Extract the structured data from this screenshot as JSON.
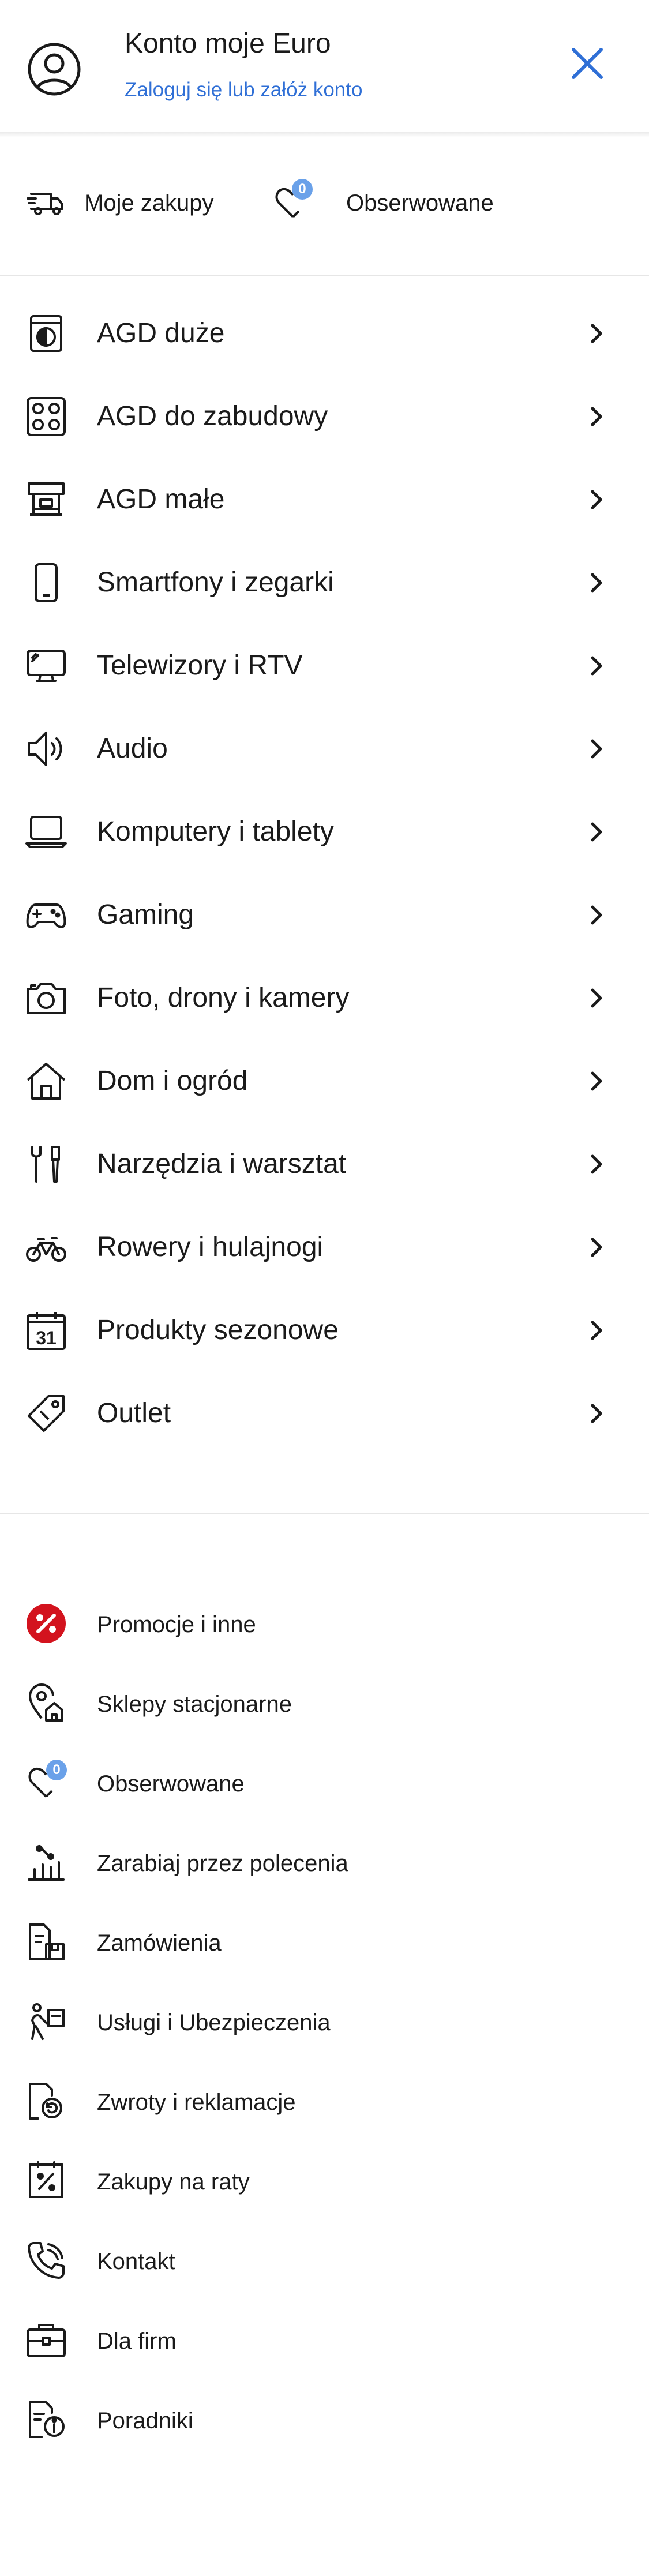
{
  "header": {
    "title": "Konto moje Euro",
    "login_link": "Zaloguj się lub załóż konto"
  },
  "quick_bar": {
    "purchases_label": "Moje zakupy",
    "watched_label": "Obserwowane",
    "watched_count": "0"
  },
  "categories": [
    {
      "label": "AGD duże",
      "icon": "washing-machine-icon"
    },
    {
      "label": "AGD do zabudowy",
      "icon": "cooktop-icon"
    },
    {
      "label": "AGD małe",
      "icon": "coffee-machine-icon"
    },
    {
      "label": "Smartfony i zegarki",
      "icon": "smartphone-icon"
    },
    {
      "label": "Telewizory i RTV",
      "icon": "tv-icon"
    },
    {
      "label": "Audio",
      "icon": "speaker-icon"
    },
    {
      "label": "Komputery i tablety",
      "icon": "laptop-icon"
    },
    {
      "label": "Gaming",
      "icon": "gamepad-icon"
    },
    {
      "label": "Foto, drony i kamery",
      "icon": "camera-icon"
    },
    {
      "label": "Dom i ogród",
      "icon": "house-icon"
    },
    {
      "label": "Narzędzia i warsztat",
      "icon": "tools-icon"
    },
    {
      "label": "Rowery i hulajnogi",
      "icon": "bicycle-icon"
    },
    {
      "label": "Produkty sezonowe",
      "icon": "calendar-icon",
      "icon_text": "31"
    },
    {
      "label": "Outlet",
      "icon": "tag-icon"
    }
  ],
  "secondary": [
    {
      "label": "Promocje i inne",
      "icon": "percent-badge-icon"
    },
    {
      "label": "Sklepy stacjonarne",
      "icon": "store-location-icon"
    },
    {
      "label": "Obserwowane",
      "icon": "heart-icon",
      "badge": "0"
    },
    {
      "label": "Zarabiaj przez polecenia",
      "icon": "referral-chart-icon"
    },
    {
      "label": "Zamówienia",
      "icon": "orders-icon"
    },
    {
      "label": "Usługi i Ubezpieczenia",
      "icon": "services-icon"
    },
    {
      "label": "Zwroty i reklamacje",
      "icon": "returns-icon"
    },
    {
      "label": "Zakupy na raty",
      "icon": "installments-icon"
    },
    {
      "label": "Kontakt",
      "icon": "phone-icon"
    },
    {
      "label": "Dla firm",
      "icon": "briefcase-icon"
    },
    {
      "label": "Poradniki",
      "icon": "guides-icon"
    }
  ],
  "colors": {
    "accent": "#2f6fd6",
    "badge": "#6aa1e9",
    "promo": "#d3131e",
    "divider": "#e6e6e6",
    "text": "#1a1a1a"
  }
}
